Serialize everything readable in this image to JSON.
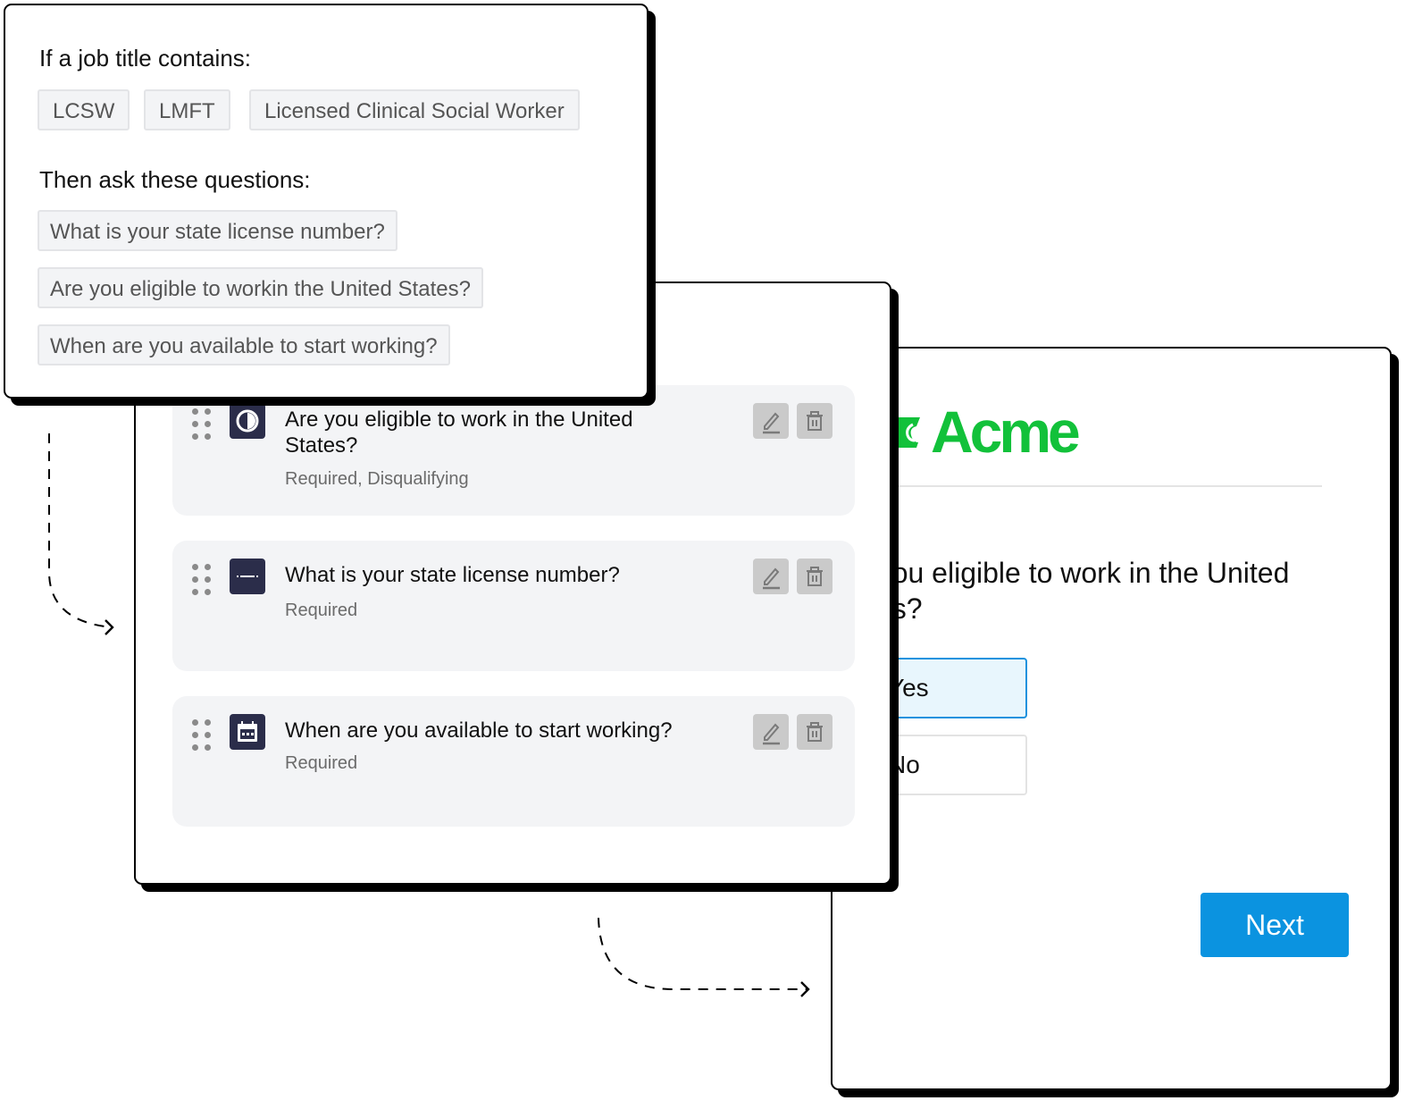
{
  "rules": {
    "condition_heading": "If a job title contains:",
    "job_title_keywords": [
      "LCSW",
      "LMFT",
      "Licensed Clinical Social Worker"
    ],
    "action_heading": "Then ask these questions:",
    "questions": [
      "What is your state license number?",
      "Are you eligible to workin the United States?",
      "When are you available to start working?"
    ]
  },
  "builder": {
    "questions": [
      {
        "title": "Are you eligible to work in the United States?",
        "meta": "Required, Disqualifying",
        "type_icon": "yes-no-icon"
      },
      {
        "title": "What is your state license number?",
        "meta": "Required",
        "type_icon": "short-text-icon"
      },
      {
        "title": "When are you available to start working?",
        "meta": "Required",
        "type_icon": "calendar-icon"
      }
    ],
    "actions": {
      "edit": "edit-icon",
      "delete": "trash-icon"
    }
  },
  "preview": {
    "brand_name": "Acme",
    "brand_color": "#12c13a",
    "question": "Are you eligible to work in the United States?",
    "options": [
      {
        "label": "Yes",
        "selected": true
      },
      {
        "label": "No",
        "selected": false
      }
    ],
    "next_label": "Next",
    "accent_color": "#0b93e0"
  }
}
